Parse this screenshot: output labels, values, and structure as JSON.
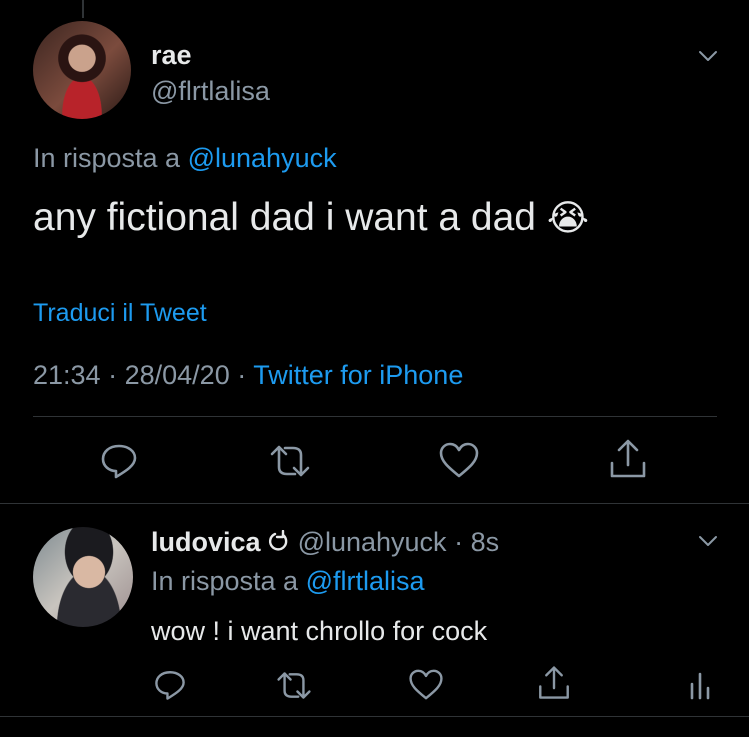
{
  "main_tweet": {
    "display_name": "rae",
    "handle": "@flrtlalisa",
    "reply_prefix": "In risposta a",
    "reply_to": "@lunahyuck",
    "text": "any fictional dad i want a dad",
    "emoji": "😭",
    "translate_label": "Traduci il Tweet",
    "time": "21:34",
    "date": "28/04/20",
    "source": "Twitter for iPhone"
  },
  "reply_tweet": {
    "display_name": "ludovica",
    "handle": "@lunahyuck",
    "time_ago": "8s",
    "reply_prefix": "In risposta a",
    "reply_to": "@flrtlalisa",
    "text": "wow ! i want chrollo for cock"
  },
  "separators": {
    "dot": "·"
  },
  "icons": {
    "reply": "reply-icon",
    "retweet": "retweet-icon",
    "like": "like-icon",
    "share": "share-icon",
    "analytics": "analytics-icon",
    "caret": "chevron-down-icon",
    "thread": "thread-refresh-icon"
  },
  "colors": {
    "background": "#000000",
    "text": "#e7e9ea",
    "muted": "#8b98a5",
    "link": "#1d9bf0",
    "divider": "#2f3336"
  }
}
